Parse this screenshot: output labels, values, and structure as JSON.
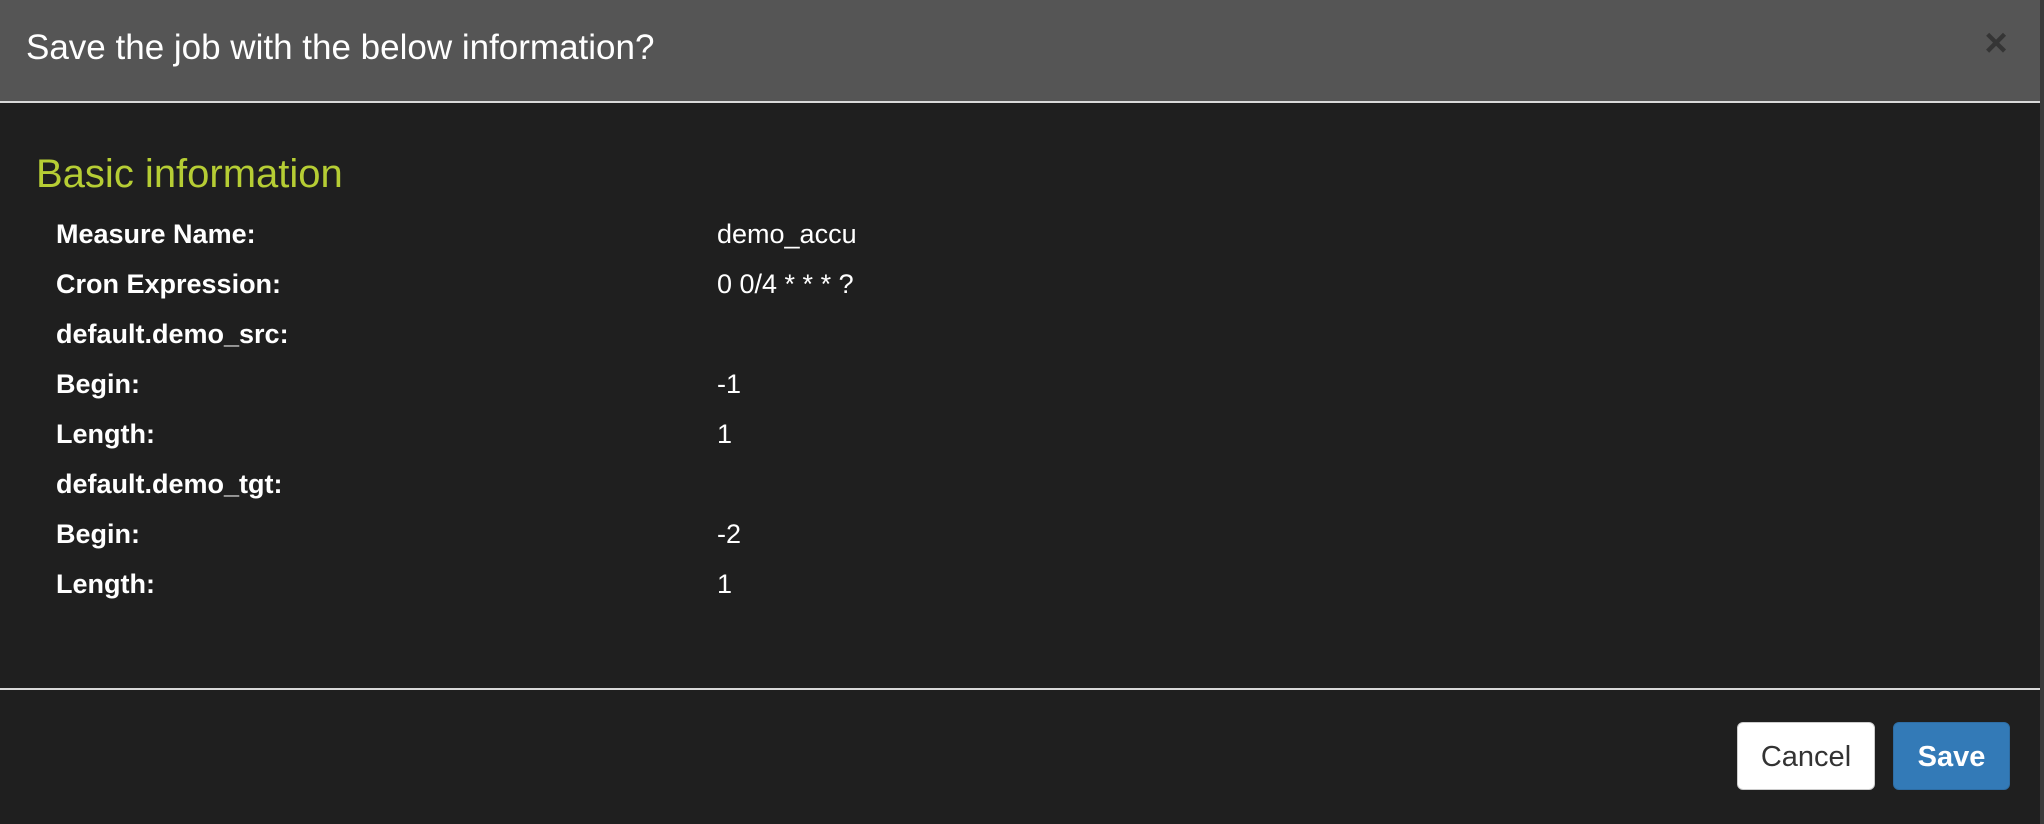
{
  "dialog": {
    "title": "Save the job with the below information?",
    "close_glyph": "×"
  },
  "basic_info": {
    "heading": "Basic information",
    "rows": [
      {
        "label": "Measure Name:",
        "value": "demo_accu"
      },
      {
        "label": "Cron Expression:",
        "value": "0 0/4 * * * ?"
      },
      {
        "label": "default.demo_src:",
        "value": ""
      },
      {
        "label": "Begin:",
        "value": "-1"
      },
      {
        "label": "Length:",
        "value": "1"
      },
      {
        "label": "default.demo_tgt:",
        "value": ""
      },
      {
        "label": "Begin:",
        "value": "-2"
      },
      {
        "label": "Length:",
        "value": "1"
      }
    ]
  },
  "footer": {
    "cancel_label": "Cancel",
    "save_label": "Save"
  },
  "colors": {
    "header_bg": "#555555",
    "body_bg": "#1f1f1f",
    "heading_accent": "#b6cd34",
    "primary": "#337ab7"
  },
  "icons": {
    "close": "close-icon"
  }
}
